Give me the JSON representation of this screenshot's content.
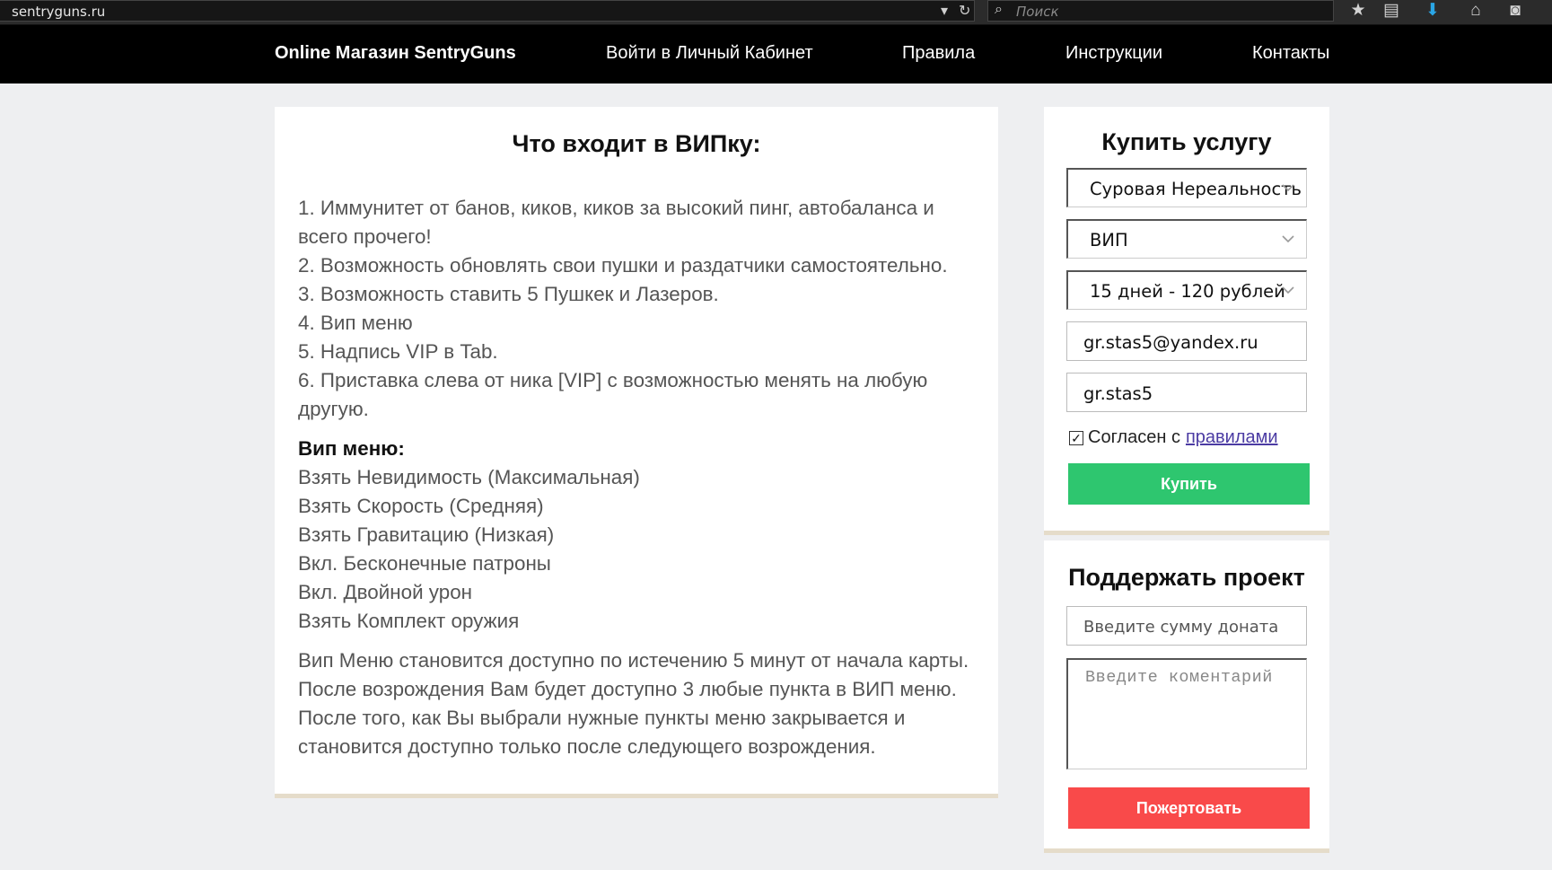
{
  "browser": {
    "url": "sentryguns.ru",
    "search_placeholder": "Поиск"
  },
  "nav": {
    "brand": "Online Магазин SentryGuns",
    "items": [
      "Войти в Личный Кабинет",
      "Правила",
      "Инструкции",
      "Контакты"
    ]
  },
  "main": {
    "title": "Что входит в ВИПку:",
    "features": [
      "1. Иммунитет от банов, киков, киков за высокий пинг, автобаланса и всего прочего!",
      "2. Возможность обновлять свои пушки и раздатчики самостоятельно.",
      "3. Возможность ставить 5 Пушкек и Лазеров.",
      "4. Вип меню",
      "5. Надпись VIP в Tab.",
      "6. Приставка слева от ника [VIP] с возможностью менять на любую другую."
    ],
    "menu_heading": "Вип меню:",
    "menu_items": [
      "Взять Невидимость (Максимальная)",
      "Взять Скорость (Средняя)",
      "Взять Гравитацию (Низкая)",
      "Вкл. Бесконечные патроны",
      "Вкл. Двойной урон",
      "Взять Комплект оружия"
    ],
    "note": "Вип Меню становится доступно по истечению 5 минут от начала карты. После возрождения Вам будет доступно 3 любые пункта в ВИП меню. После того, как Вы выбрали нужные пункты меню закрывается и становится доступно только после следующего возрождения."
  },
  "buy": {
    "title": "Купить услугу",
    "server": "Суровая Нереальность",
    "privilege": "ВИП",
    "period": "15 дней - 120 рублей",
    "email": "gr.stas5@yandex.ru",
    "nickname": "gr.stas5",
    "agree_text": "Согласен с",
    "agree_link": "правилами",
    "agree_checked": true,
    "button": "Купить"
  },
  "donate": {
    "title": "Поддержать проект",
    "amount_placeholder": "Введите сумму доната",
    "comment_placeholder": "Введите коментарий",
    "button": "Пожертовать"
  },
  "colors": {
    "buy_button": "#2ec66f",
    "donate_button": "#f94a4a",
    "nav_bg": "#000000",
    "link": "#4b3ba3"
  }
}
